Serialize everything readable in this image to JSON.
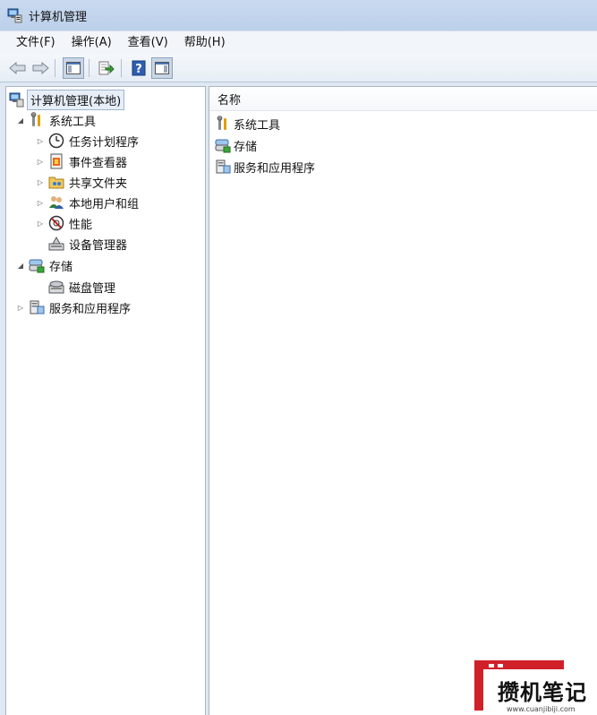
{
  "window": {
    "title": "计算机管理",
    "menu": [
      "文件(F)",
      "操作(A)",
      "查看(V)",
      "帮助(H)"
    ]
  },
  "toolbar": {
    "buttons": [
      "back",
      "forward",
      "show-hide-console-tree",
      "export-list",
      "help",
      "show-hide-action-pane"
    ]
  },
  "tree": {
    "root": "计算机管理(本地)",
    "items": [
      {
        "label": "系统工具",
        "level": 1,
        "expander": "expanded",
        "icon": "tools-icon"
      },
      {
        "label": "任务计划程序",
        "level": 2,
        "expander": "collapsed",
        "icon": "clock-icon"
      },
      {
        "label": "事件查看器",
        "level": 2,
        "expander": "collapsed",
        "icon": "event-viewer-icon"
      },
      {
        "label": "共享文件夹",
        "level": 2,
        "expander": "collapsed",
        "icon": "shared-folder-icon"
      },
      {
        "label": "本地用户和组",
        "level": 2,
        "expander": "collapsed",
        "icon": "users-icon"
      },
      {
        "label": "性能",
        "level": 2,
        "expander": "collapsed",
        "icon": "performance-icon"
      },
      {
        "label": "设备管理器",
        "level": 2,
        "expander": "none",
        "icon": "device-manager-icon"
      },
      {
        "label": "存储",
        "level": 1,
        "expander": "expanded",
        "icon": "storage-icon"
      },
      {
        "label": "磁盘管理",
        "level": 2,
        "expander": "none",
        "icon": "disk-icon"
      },
      {
        "label": "服务和应用程序",
        "level": 1,
        "expander": "collapsed",
        "icon": "services-icon"
      }
    ]
  },
  "list": {
    "header": "名称",
    "rows": [
      "系统工具",
      "存储",
      "服务和应用程序"
    ]
  },
  "watermark": {
    "text": "攒机笔记",
    "url": "www.cuanjibiji.com"
  },
  "colors": {
    "titlebar": "#c9daf0",
    "accent": "#d0202a"
  }
}
